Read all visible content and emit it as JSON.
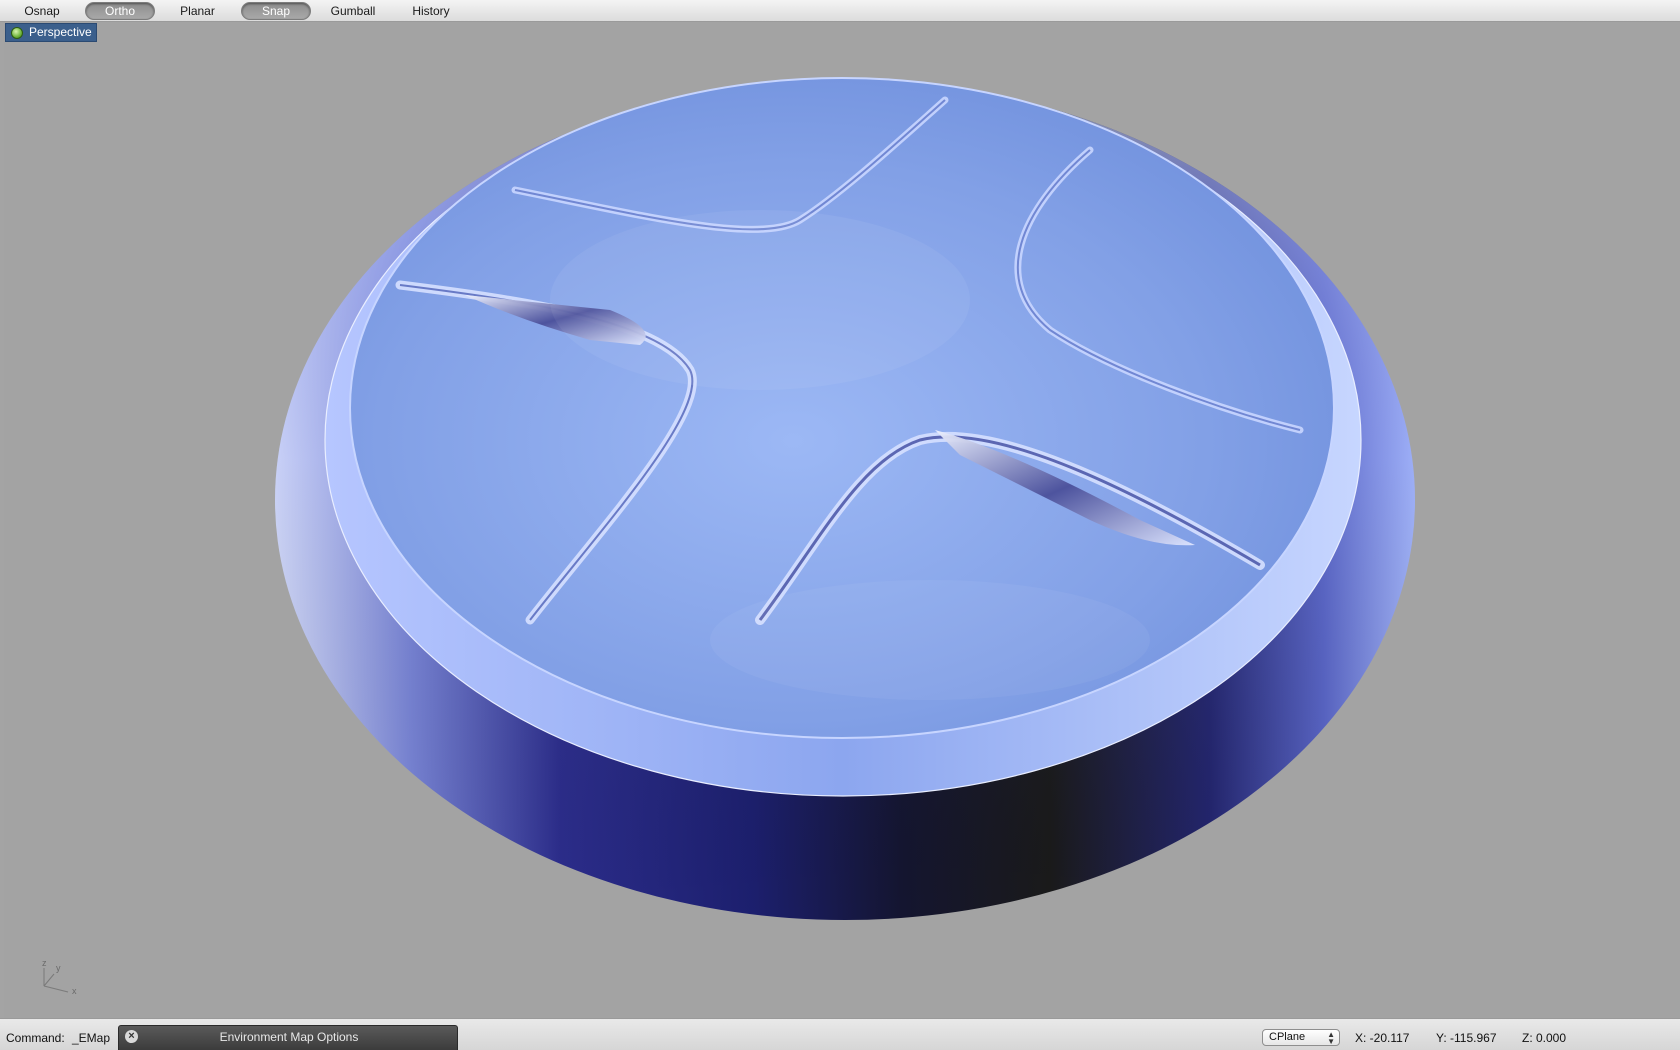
{
  "toolbar": {
    "toggles": [
      {
        "label": "Osnap",
        "active": false
      },
      {
        "label": "Ortho",
        "active": true
      },
      {
        "label": "Planar",
        "active": false
      },
      {
        "label": "Snap",
        "active": true
      },
      {
        "label": "Gumball",
        "active": false
      },
      {
        "label": "History",
        "active": false
      }
    ]
  },
  "viewport": {
    "title": "Perspective",
    "status_icon": "green-dot-icon",
    "background_color": "#a3a3a3",
    "object_tint": "#7d9be0",
    "axes": {
      "x": "x",
      "y": "y",
      "z": "z"
    }
  },
  "command": {
    "label": "Command:",
    "value": "_EMap"
  },
  "env_panel": {
    "title": "Environment Map Options",
    "close_icon": "close-circle-icon"
  },
  "status": {
    "cplane": "CPlane",
    "x": "X: -20.117",
    "y": "Y: -115.967",
    "z": "Z: 0.000"
  }
}
